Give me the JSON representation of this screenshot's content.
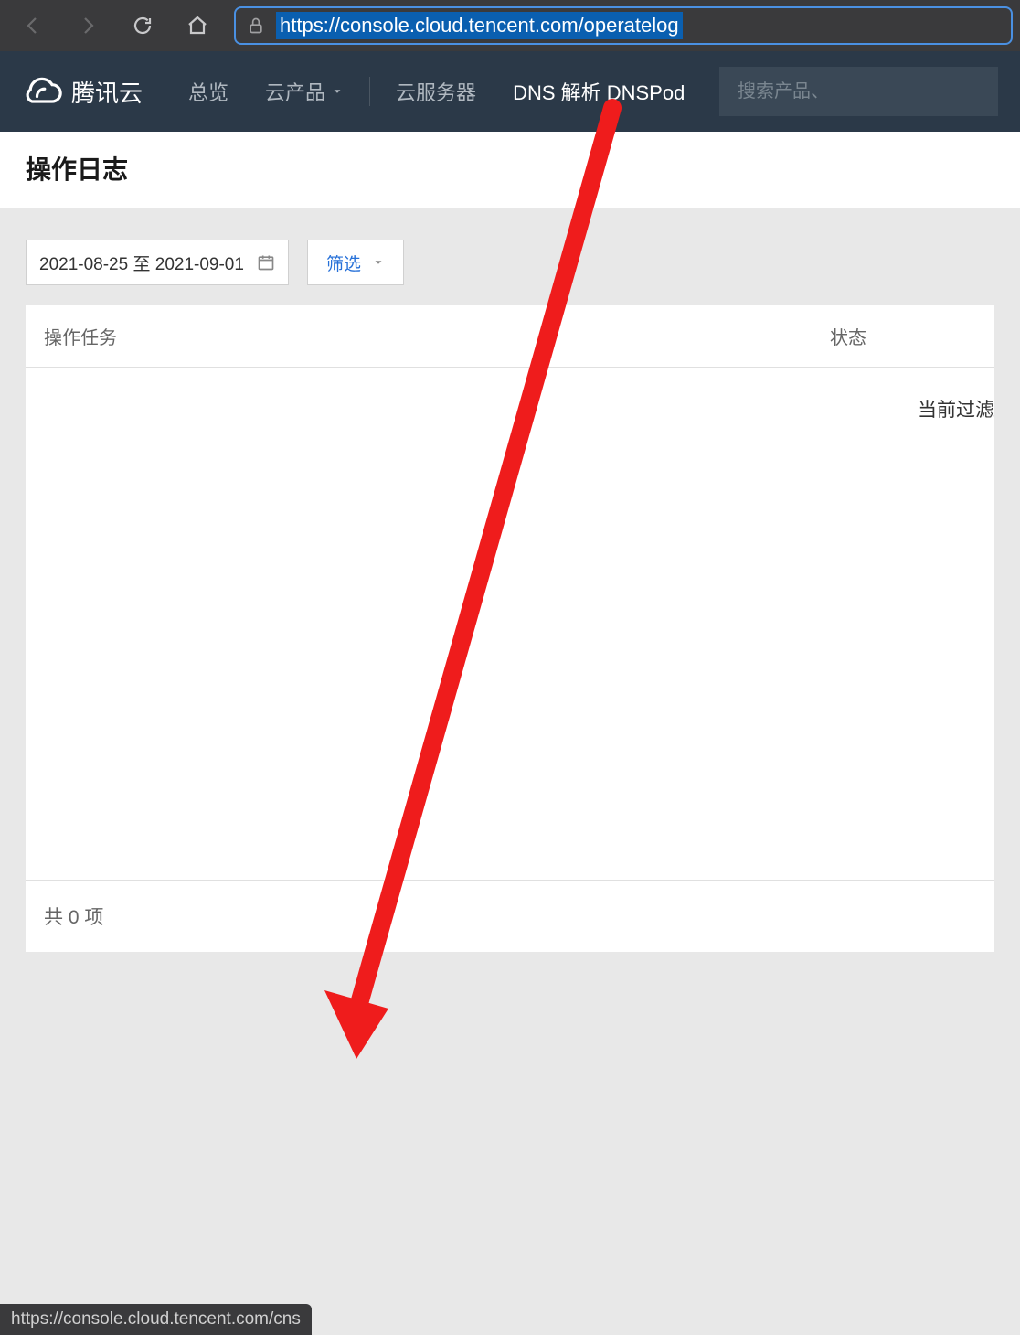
{
  "browser": {
    "url": "https://console.cloud.tencent.com/operatelog"
  },
  "nav": {
    "brand": "腾讯云",
    "items": [
      {
        "label": "总览"
      },
      {
        "label": "云产品",
        "has_dropdown": true
      },
      {
        "label": "云服务器"
      },
      {
        "label": "DNS 解析 DNSPod",
        "active": true
      }
    ],
    "search_placeholder": "搜索产品、"
  },
  "page": {
    "title": "操作日志"
  },
  "toolbar": {
    "date_range": "2021-08-25 至 2021-09-01",
    "filter_label": "筛选"
  },
  "table": {
    "columns": {
      "task": "操作任务",
      "status": "状态"
    },
    "empty_text": "当前过滤",
    "footer": "共 0 项"
  },
  "status_bar": {
    "hover_url": "https://console.cloud.tencent.com/cns"
  }
}
